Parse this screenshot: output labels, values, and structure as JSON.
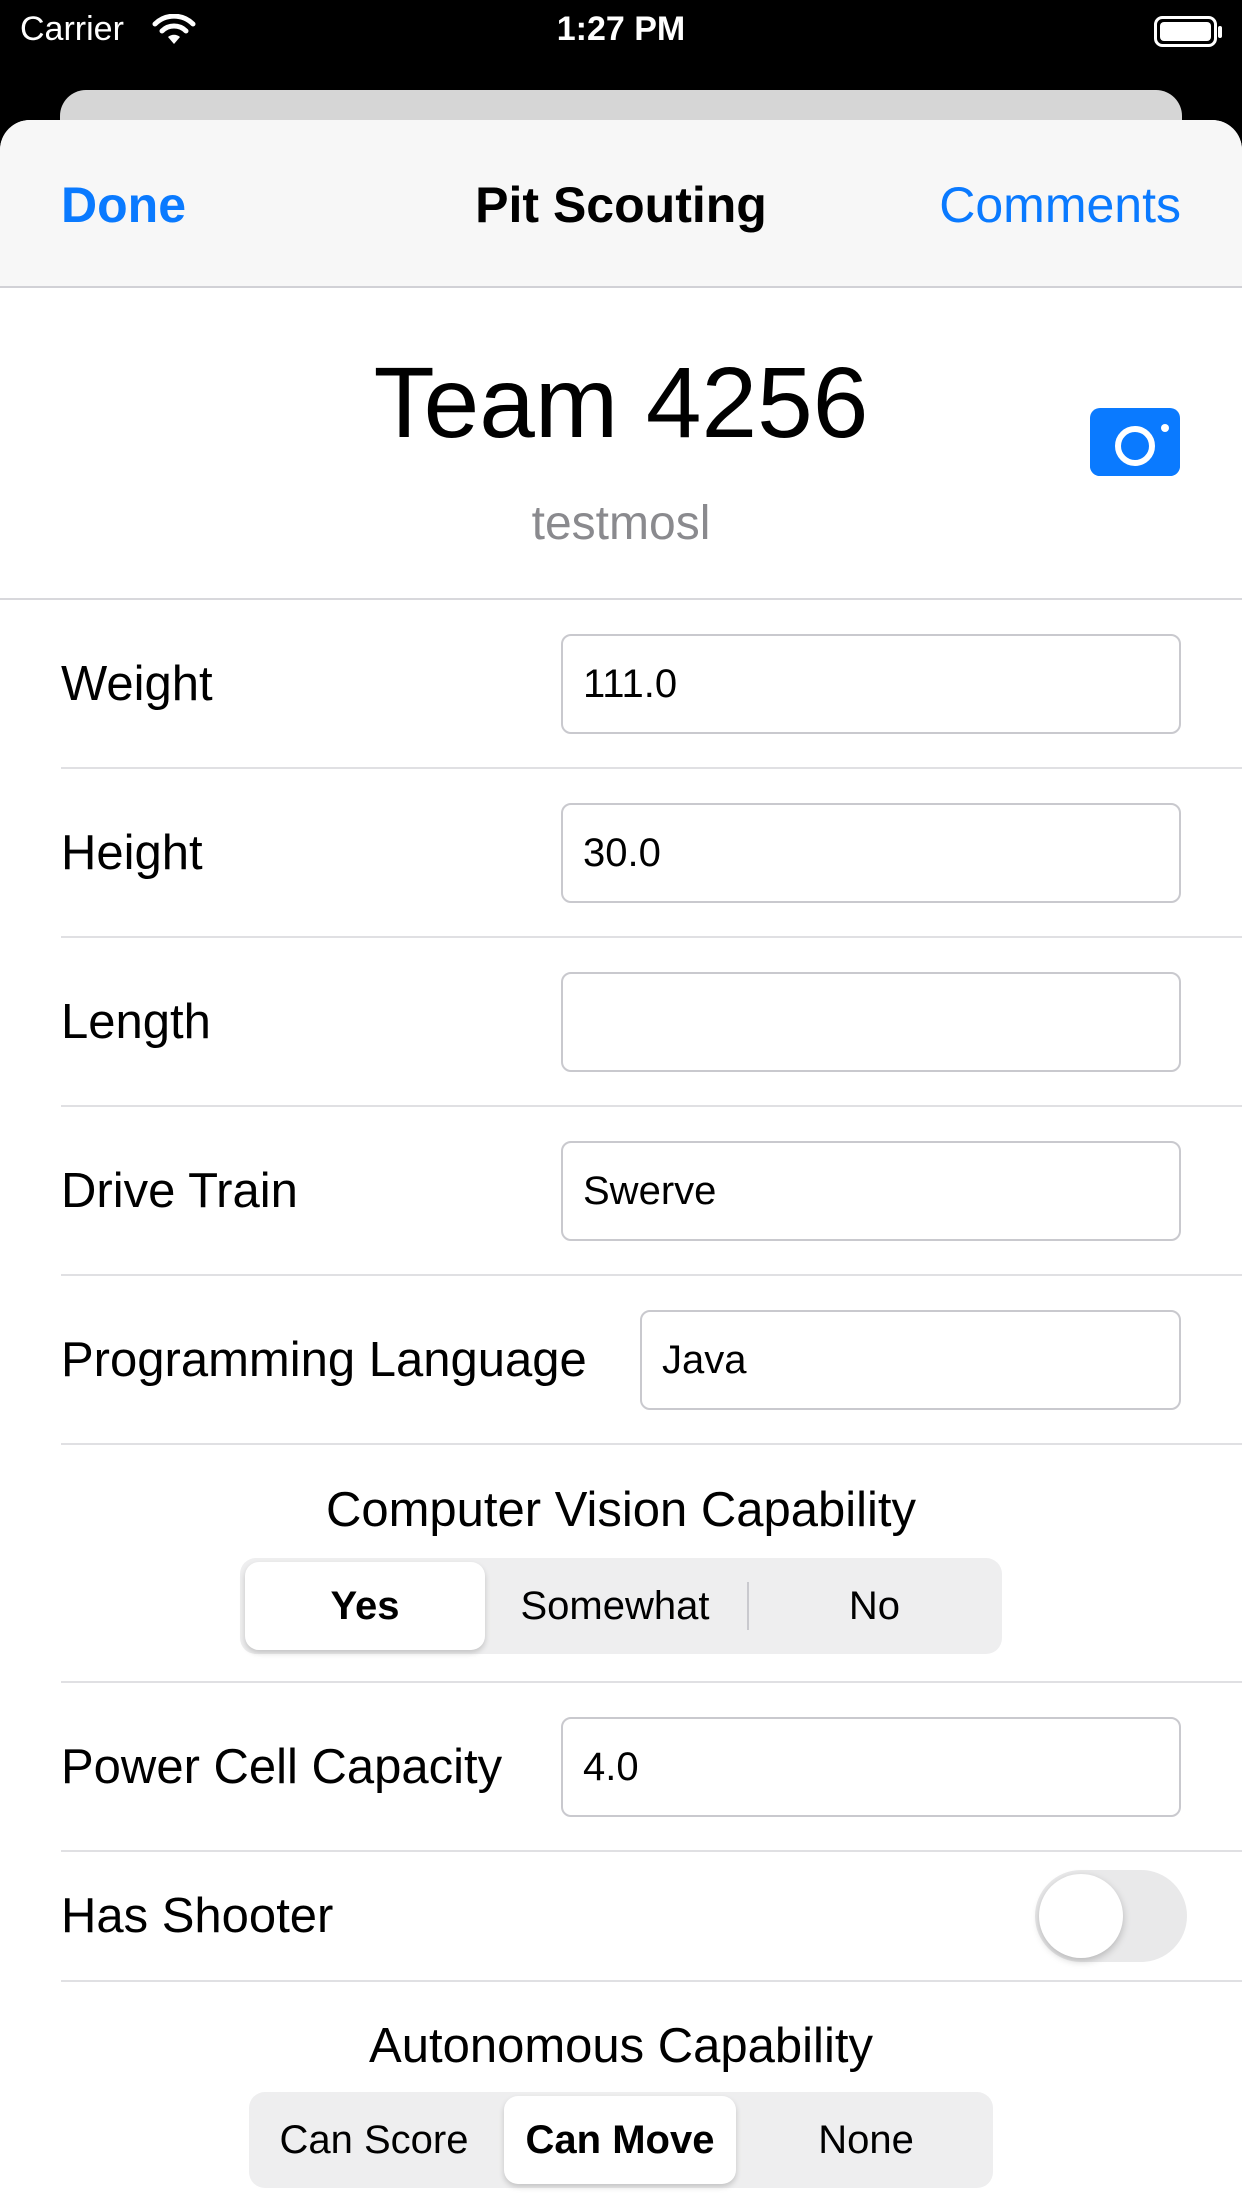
{
  "status_bar": {
    "carrier": "Carrier",
    "time": "1:27 PM"
  },
  "nav": {
    "done": "Done",
    "title": "Pit Scouting",
    "comments": "Comments"
  },
  "header": {
    "team": "Team 4256",
    "subtitle": "testmosl",
    "camera_icon": "camera-icon"
  },
  "fields": {
    "weight": {
      "label": "Weight",
      "value": "111.0"
    },
    "height": {
      "label": "Height",
      "value": "30.0"
    },
    "length": {
      "label": "Length",
      "value": ""
    },
    "drive_train": {
      "label": "Drive Train",
      "value": "Swerve"
    },
    "programming_language": {
      "label": "Programming Language",
      "value": "Java"
    },
    "power_cell_capacity": {
      "label": "Power Cell Capacity",
      "value": "4.0"
    },
    "has_shooter": {
      "label": "Has Shooter",
      "on": false
    }
  },
  "vision": {
    "title": "Computer Vision Capability",
    "options": [
      "Yes",
      "Somewhat",
      "No"
    ],
    "selected": "Yes"
  },
  "autonomous": {
    "title": "Autonomous Capability",
    "options": [
      "Can Score",
      "Can Move",
      "None"
    ],
    "selected": "Can Move"
  },
  "colors": {
    "accent": "#0a7aff",
    "subtitle": "#8a8a8e",
    "toggle_off": "#e9e9ea"
  }
}
